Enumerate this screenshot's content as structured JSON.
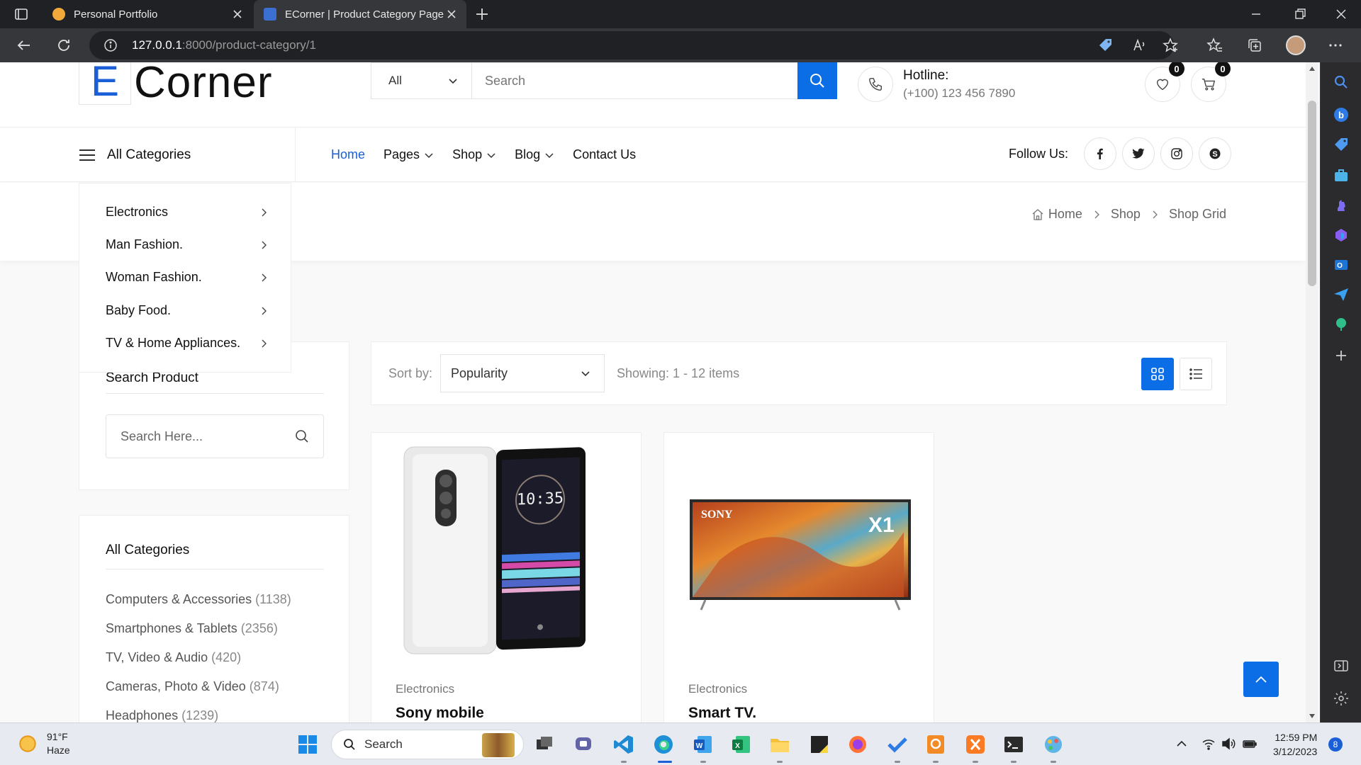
{
  "browser": {
    "tabs": [
      {
        "title": "Personal Portfolio",
        "favicon_color": "#f2a93b"
      },
      {
        "title": "ECorner | Product Category Page",
        "favicon_color": "#3b6fd1"
      }
    ],
    "url_host": "127.0.0.1",
    "url_path": ":8000/product-category/1",
    "profile_badge": ""
  },
  "header": {
    "logo_letter": "E",
    "logo_text": "Corner",
    "search_category": "All",
    "search_placeholder": "Search",
    "hotline_label": "Hotline:",
    "hotline_number": "(+100) 123 456 7890",
    "wishlist_count": "0",
    "cart_count": "0"
  },
  "nav": {
    "all_categories": "All Categories",
    "items": [
      {
        "label": "Home",
        "active": true
      },
      {
        "label": "Pages",
        "dropdown": true
      },
      {
        "label": "Shop",
        "dropdown": true
      },
      {
        "label": "Blog",
        "dropdown": true
      },
      {
        "label": "Contact Us"
      }
    ],
    "follow_label": "Follow Us:",
    "social_icons": [
      "facebook-icon",
      "twitter-icon",
      "instagram-icon",
      "skype-icon"
    ]
  },
  "breadcrumb": [
    "Home",
    "Shop",
    "Shop Grid"
  ],
  "category_dropdown": [
    "Electronics",
    "Man Fashion.",
    "Woman Fashion.",
    "Baby Food.",
    "TV & Home Appliances."
  ],
  "sidebar": {
    "search_title": "Search Product",
    "search_placeholder": "Search Here...",
    "categories_title": "All Categories",
    "categories": [
      {
        "name": "Computers & Accessories",
        "count": "(1138)"
      },
      {
        "name": "Smartphones & Tablets",
        "count": "(2356)"
      },
      {
        "name": "TV, Video & Audio",
        "count": "(420)"
      },
      {
        "name": "Cameras, Photo & Video",
        "count": "(874)"
      },
      {
        "name": "Headphones",
        "count": "(1239)"
      }
    ]
  },
  "toolbar": {
    "sort_label": "Sort by:",
    "sort_value": "Popularity",
    "showing": "Showing: 1 - 12 items"
  },
  "products": [
    {
      "category": "Electronics",
      "name": "Sony mobile",
      "screen_time": "10:35"
    },
    {
      "category": "Electronics",
      "name": "Smart TV.",
      "brand": "SONY",
      "badge": "X1"
    }
  ],
  "taskbar": {
    "weather_temp": "91°F",
    "weather_desc": "Haze",
    "search_label": "Search",
    "time": "12:59 PM",
    "date": "3/12/2023",
    "notifications": "8"
  },
  "colors": {
    "accent": "#0c6ee6",
    "dark_chrome": "#202124"
  }
}
